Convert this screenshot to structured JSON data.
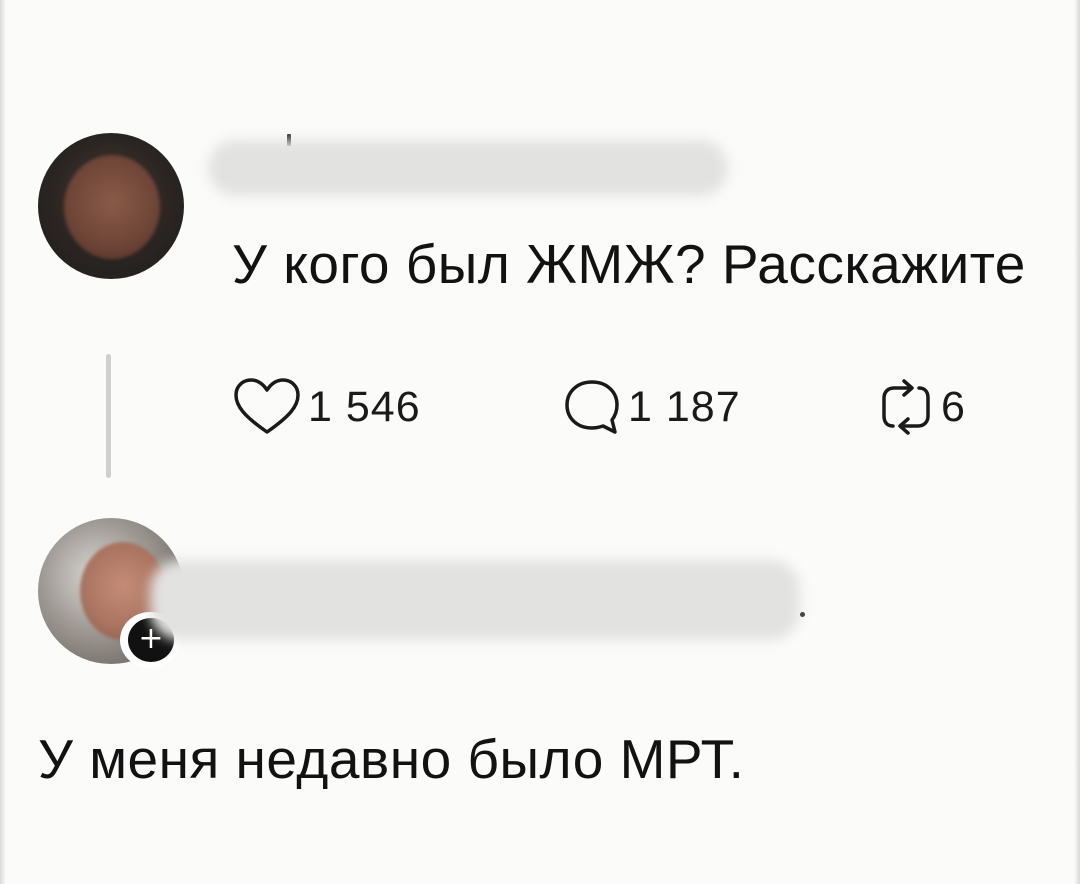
{
  "post": {
    "text": "У кого был ЖМЖ? Расскажите",
    "likes": "1 546",
    "comments": "1 187",
    "reposts": "6",
    "icons": {
      "like": "heart-icon",
      "comment": "comment-bubble-icon",
      "repost": "repost-icon"
    }
  },
  "reply": {
    "text": "У меня недавно было МРТ.",
    "follow_badge": "+"
  }
}
